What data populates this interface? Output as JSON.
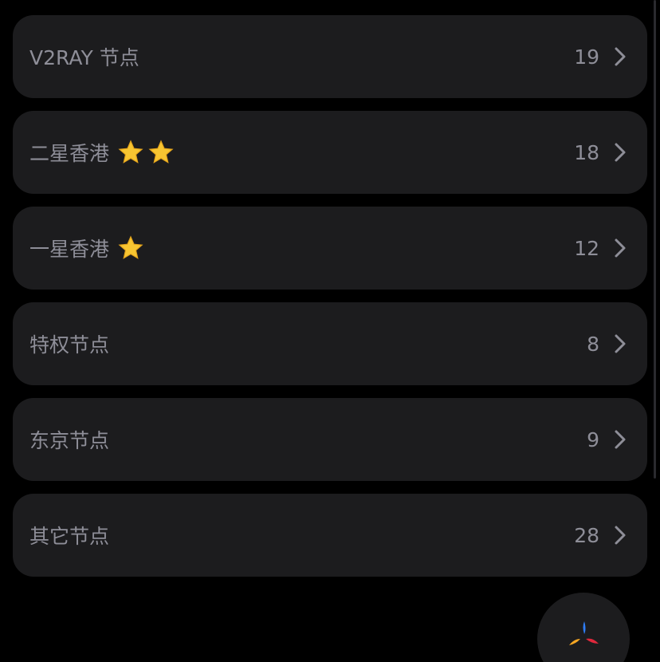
{
  "groups": [
    {
      "name": "V2RAY 节点",
      "count": "19",
      "stars": 0
    },
    {
      "name": "二星香港",
      "count": "18",
      "stars": 2
    },
    {
      "name": "一星香港",
      "count": "12",
      "stars": 1
    },
    {
      "name": "特权节点",
      "count": "8",
      "stars": 0
    },
    {
      "name": "东京节点",
      "count": "9",
      "stars": 0
    },
    {
      "name": "其它节点",
      "count": "28",
      "stars": 0
    }
  ],
  "icons": {
    "chevron": "chevron-right-icon",
    "star": "star-icon",
    "fab": "tri-color-logo-icon"
  },
  "colors": {
    "background": "#000000",
    "row_background": "#1c1c1e",
    "text": "#8e8e98",
    "star": "#f7c531",
    "logo_blue": "#2f7df6",
    "logo_orange": "#f5a623",
    "logo_red": "#e0283c"
  }
}
